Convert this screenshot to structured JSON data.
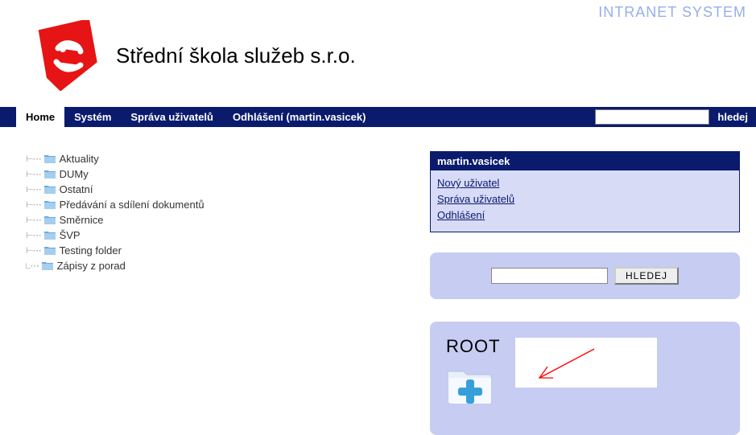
{
  "header": {
    "system_label": "INTRANET SYSTEM",
    "school_name": "Střední škola služeb s.r.o."
  },
  "nav": {
    "items": [
      {
        "label": "Home",
        "active": true
      },
      {
        "label": "Systém",
        "active": false
      },
      {
        "label": "Správa uživatelů",
        "active": false
      },
      {
        "label": "Odhlášení (martin.vasicek)",
        "active": false
      }
    ],
    "search_button": "hledej"
  },
  "tree": [
    "Aktuality",
    "DUMy",
    "Ostatní",
    "Předávání a sdílení dokumentů",
    "Směrnice",
    "ŠVP",
    "Testing folder",
    "Zápisy z porad"
  ],
  "userbox": {
    "username": "martin.vasicek",
    "links": [
      "Nový uživatel",
      "Správa uživatelů",
      "Odhlášení"
    ]
  },
  "search_panel": {
    "button": "HLEDEJ"
  },
  "root_panel": {
    "label": "ROOT"
  }
}
